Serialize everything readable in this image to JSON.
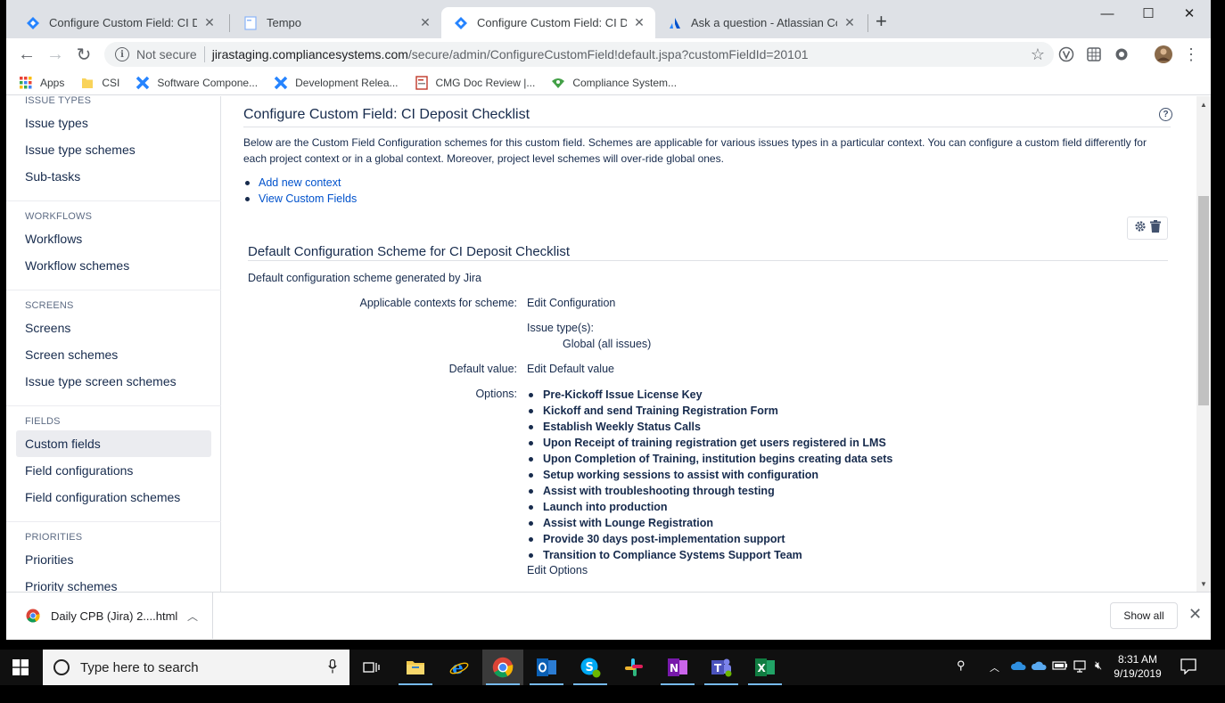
{
  "browser": {
    "tabs": [
      {
        "title": "Configure Custom Field: CI Deposit Checklist",
        "icon": "jira-icon",
        "active": false
      },
      {
        "title": "Tempo",
        "icon": "document-icon",
        "active": false
      },
      {
        "title": "Configure Custom Field: CI Deposit Checklist",
        "icon": "jira-icon",
        "active": true
      },
      {
        "title": "Ask a question - Atlassian Community",
        "icon": "atlassian-icon",
        "active": false
      }
    ],
    "new_tab": "+",
    "security_label": "Not secure",
    "url_domain": "jirastaging.compliancesystems.com",
    "url_path": "/secure/admin/ConfigureCustomField!default.jspa?customFieldId=20101",
    "bookmarks": [
      {
        "label": "Apps",
        "icon": "apps-grid-icon"
      },
      {
        "label": "CSI",
        "icon": "folder-icon"
      },
      {
        "label": "Software Compone...",
        "icon": "jira-icon"
      },
      {
        "label": "Development Relea...",
        "icon": "jira-icon"
      },
      {
        "label": "CMG Doc Review |...",
        "icon": "doc-review-icon"
      },
      {
        "label": "Compliance System...",
        "icon": "compliance-icon"
      }
    ]
  },
  "sidebar": {
    "partial_header": "ISSUE TYPES",
    "sections": [
      {
        "header": "",
        "items": [
          "Issue types",
          "Issue type schemes",
          "Sub-tasks"
        ]
      },
      {
        "header": "WORKFLOWS",
        "items": [
          "Workflows",
          "Workflow schemes"
        ]
      },
      {
        "header": "SCREENS",
        "items": [
          "Screens",
          "Screen schemes",
          "Issue type screen schemes"
        ]
      },
      {
        "header": "FIELDS",
        "items": [
          "Custom fields",
          "Field configurations",
          "Field configuration schemes"
        ]
      },
      {
        "header": "PRIORITIES",
        "items": [
          "Priorities",
          "Priority schemes"
        ]
      }
    ],
    "selected": "Custom fields"
  },
  "main": {
    "title": "Configure Custom Field: CI Deposit Checklist",
    "description": "Below are the Custom Field Configuration schemes for this custom field. Schemes are applicable for various issues types in a particular context. You can configure a custom field differently for each project context or in a global context. Moreover, project level schemes will over-ride global ones.",
    "links": [
      "Add new context",
      "View Custom Fields"
    ],
    "scheme": {
      "title": "Default Configuration Scheme for CI Deposit Checklist",
      "description": "Default configuration scheme generated by Jira",
      "contexts_label": "Applicable contexts for scheme:",
      "edit_configuration": "Edit Configuration",
      "issue_types_label": "Issue type(s):",
      "issue_types_value": "Global (all issues)",
      "default_value_label": "Default value:",
      "edit_default_value": "Edit Default value",
      "options_label": "Options:",
      "options": [
        "Pre-Kickoff Issue License Key",
        "Kickoff and send Training Registration Form",
        "Establish Weekly Status Calls",
        "Upon Receipt of training registration get users registered in LMS",
        "Upon Completion of Training, institution begins creating data sets",
        "Setup working sessions to assist with configuration",
        "Assist with troubleshooting through testing",
        "Launch into production",
        "Assist with Lounge Registration",
        "Provide 30 days post-implementation support",
        "Transition to Compliance Systems Support Team"
      ],
      "edit_options": "Edit Options"
    }
  },
  "downloads": {
    "file": "Daily CPB (Jira) 2....html",
    "show_all": "Show all"
  },
  "taskbar": {
    "search_placeholder": "Type here to search",
    "time": "8:31 AM",
    "date": "9/19/2019"
  },
  "colors": {
    "link": "#0052cc",
    "text": "#172b4d",
    "selected_bg": "#ebecf0"
  }
}
